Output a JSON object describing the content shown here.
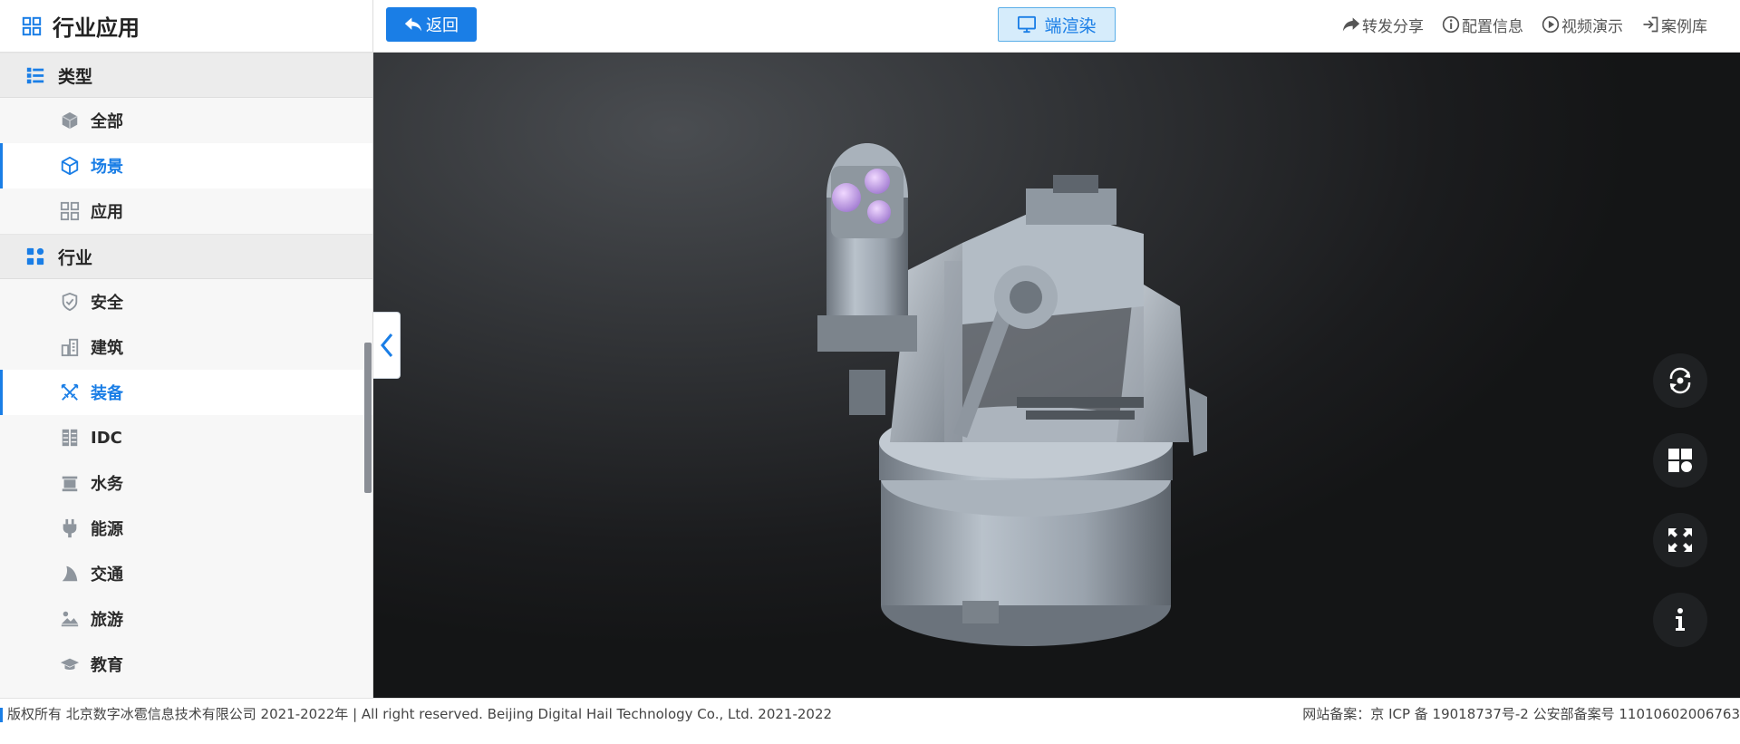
{
  "sidebar": {
    "title": "行业应用",
    "sections": [
      {
        "label": "类型",
        "items": [
          {
            "label": "全部",
            "icon": "layers-icon",
            "active": false
          },
          {
            "label": "场景",
            "icon": "cube-icon",
            "active": true
          },
          {
            "label": "应用",
            "icon": "apps-grid-icon",
            "active": false
          }
        ]
      },
      {
        "label": "行业",
        "items": [
          {
            "label": "安全",
            "icon": "shield-check-icon",
            "active": false
          },
          {
            "label": "建筑",
            "icon": "building-icon",
            "active": false
          },
          {
            "label": "装备",
            "icon": "crossed-swords-icon",
            "active": true
          },
          {
            "label": "IDC",
            "icon": "server-rack-icon",
            "active": false
          },
          {
            "label": "水务",
            "icon": "water-icon",
            "active": false
          },
          {
            "label": "能源",
            "icon": "plug-icon",
            "active": false
          },
          {
            "label": "交通",
            "icon": "road-icon",
            "active": false
          },
          {
            "label": "旅游",
            "icon": "travel-icon",
            "active": false
          },
          {
            "label": "教育",
            "icon": "graduation-cap-icon",
            "active": false
          }
        ]
      }
    ]
  },
  "topbar": {
    "back_label": "返回",
    "render_label": "端渲染",
    "actions": {
      "share": "转发分享",
      "config": "配置信息",
      "video": "视频演示",
      "cases": "案例库"
    }
  },
  "viewport": {
    "controls": [
      "rotate-icon",
      "layout-icon",
      "fullscreen-icon",
      "info-icon"
    ]
  },
  "footer": {
    "copyright": "版权所有 北京数字冰雹信息技术有限公司 2021-2022年 | All right reserved. Beijing Digital Hail Technology Co., Ltd. 2021-2022",
    "icp": "网站备案：京 ICP 备 19018737号-2 公安部备案号 11010602006763"
  },
  "colors": {
    "accent": "#1a7ee6",
    "render_bg": "#d6ecfb",
    "viewport_dark": "#1b1c1e"
  }
}
